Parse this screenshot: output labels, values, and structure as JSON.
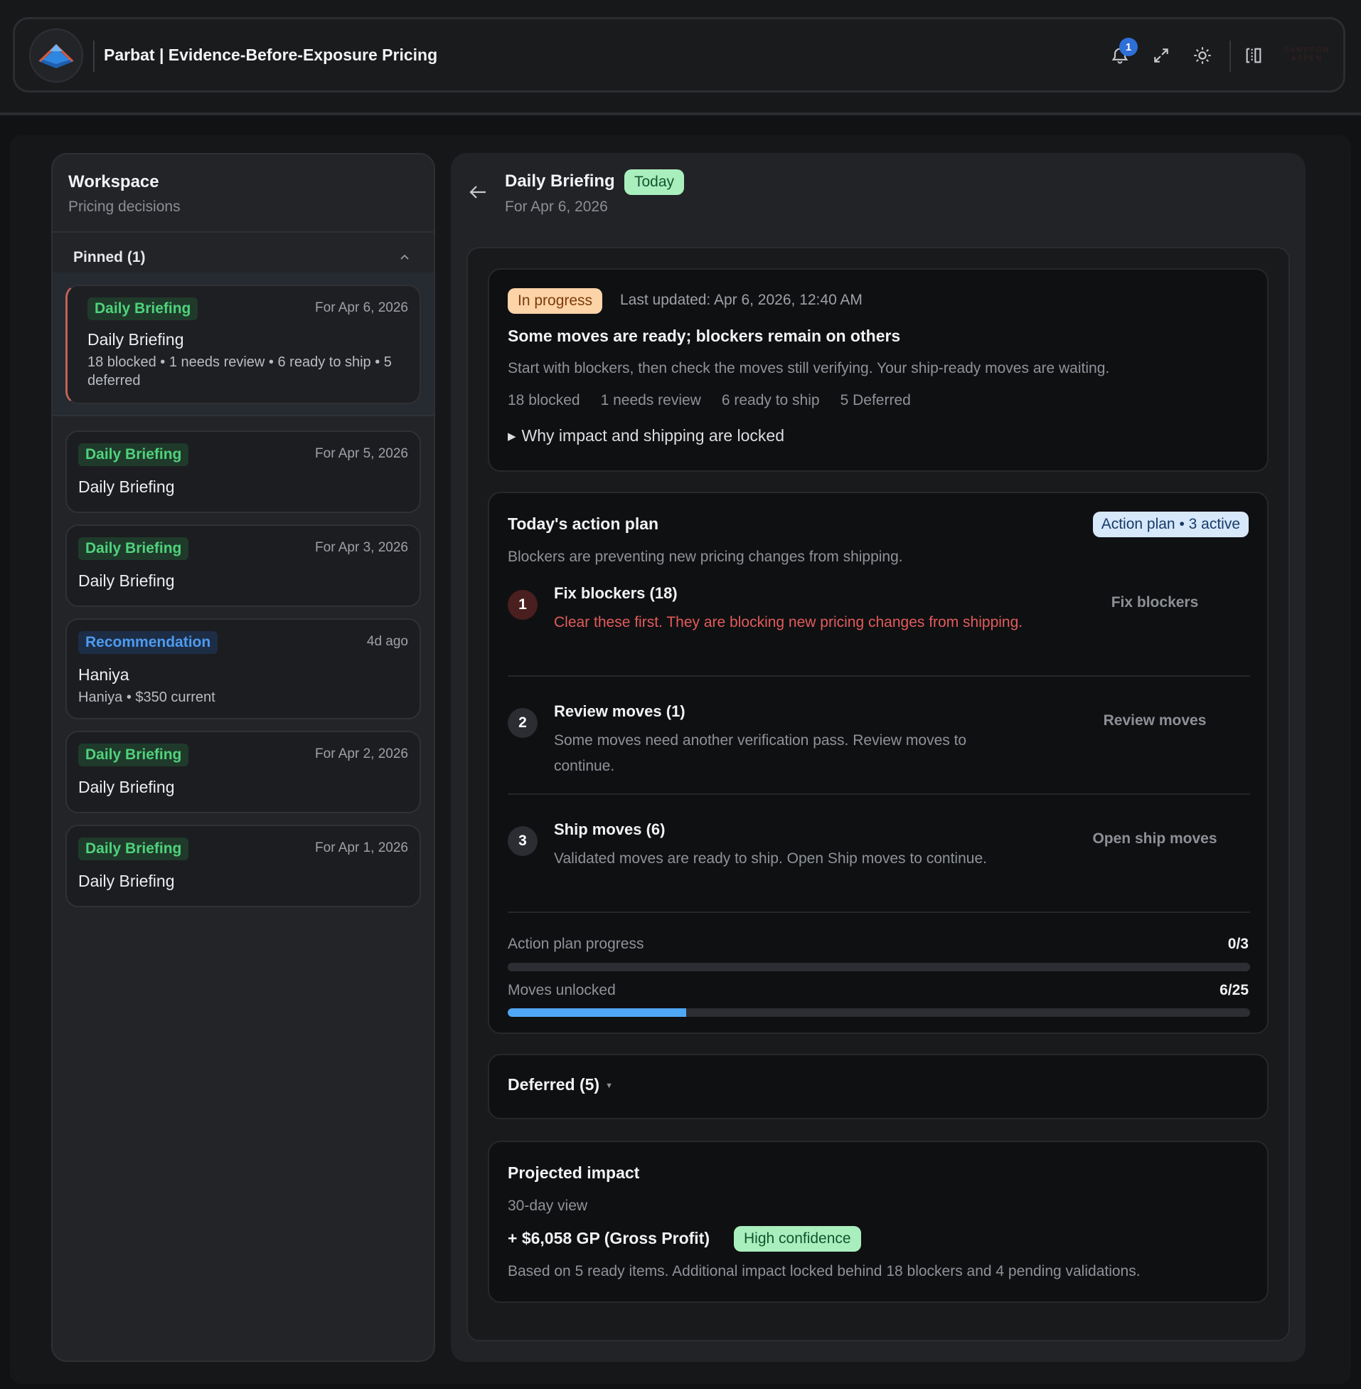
{
  "header": {
    "app_title": "Parbat | Evidence-Before-Exposure Pricing",
    "notification_count": "1",
    "brand_mark": "SAMPSON ASPEN"
  },
  "sidebar": {
    "title": "Workspace",
    "subtitle": "Pricing decisions",
    "pinned_label": "Pinned (1)",
    "pinned_card": {
      "chip": "Daily Briefing",
      "date": "For Apr 6, 2026",
      "title": "Daily Briefing",
      "summary": "18 blocked • 1 needs review • 6 ready to ship • 5 deferred"
    },
    "cards": [
      {
        "chip": "Daily Briefing",
        "chip_color": "green",
        "date": "For Apr 5, 2026",
        "title": "Daily Briefing",
        "summary": ""
      },
      {
        "chip": "Daily Briefing",
        "chip_color": "green",
        "date": "For Apr 3, 2026",
        "title": "Daily Briefing",
        "summary": ""
      },
      {
        "chip": "Recommendation",
        "chip_color": "blue",
        "date": "4d ago",
        "title": "Haniya",
        "summary": "Haniya • $350 current"
      },
      {
        "chip": "Daily Briefing",
        "chip_color": "green",
        "date": "For Apr 2, 2026",
        "title": "Daily Briefing",
        "summary": ""
      },
      {
        "chip": "Daily Briefing",
        "chip_color": "green",
        "date": "For Apr 1, 2026",
        "title": "Daily Briefing",
        "summary": ""
      }
    ]
  },
  "briefing": {
    "title": "Daily Briefing",
    "today_chip": "Today",
    "subtitle": "For Apr 6, 2026",
    "status": {
      "chip": "In progress",
      "last_updated": "Last updated: Apr 6, 2026, 12:40 AM",
      "headline": "Some moves are ready; blockers remain on others",
      "description": "Start with blockers, then check the moves still verifying. Your ship-ready moves are waiting.",
      "stats": [
        "18 blocked",
        "1 needs review",
        "6 ready to ship",
        "5 Deferred"
      ],
      "why_link": "Why impact and shipping are locked"
    },
    "action_plan": {
      "title": "Today's action plan",
      "chip": "Action plan • 3 active",
      "description": "Blockers are preventing new pricing changes from shipping.",
      "steps": [
        {
          "num": "1",
          "title": "Fix blockers (18)",
          "desc": "Clear these first. They are blocking new pricing changes from shipping.",
          "button": "Fix blockers"
        },
        {
          "num": "2",
          "title": "Review moves (1)",
          "desc": "Some moves need another verification pass. Review moves to continue.",
          "button": "Review moves"
        },
        {
          "num": "3",
          "title": "Ship moves (6)",
          "desc": "Validated moves are ready to ship. Open Ship moves to continue.",
          "button": "Open ship moves"
        }
      ],
      "progress_label": "Action plan progress",
      "progress_value": "0/3",
      "progress_fraction": 0,
      "unlocked_label": "Moves unlocked",
      "unlocked_value": "6/25",
      "unlocked_fraction": 0.24,
      "bar_color": "#4fa8f5"
    },
    "deferred": {
      "title": "Deferred (5)"
    },
    "impact": {
      "title": "Projected impact",
      "subtitle": "30-day view",
      "value": "+ $6,058 GP (Gross Profit)",
      "confidence": "High confidence",
      "note": "Based on 5 ready items. Additional impact locked behind 18 blockers and 4 pending validations."
    }
  }
}
